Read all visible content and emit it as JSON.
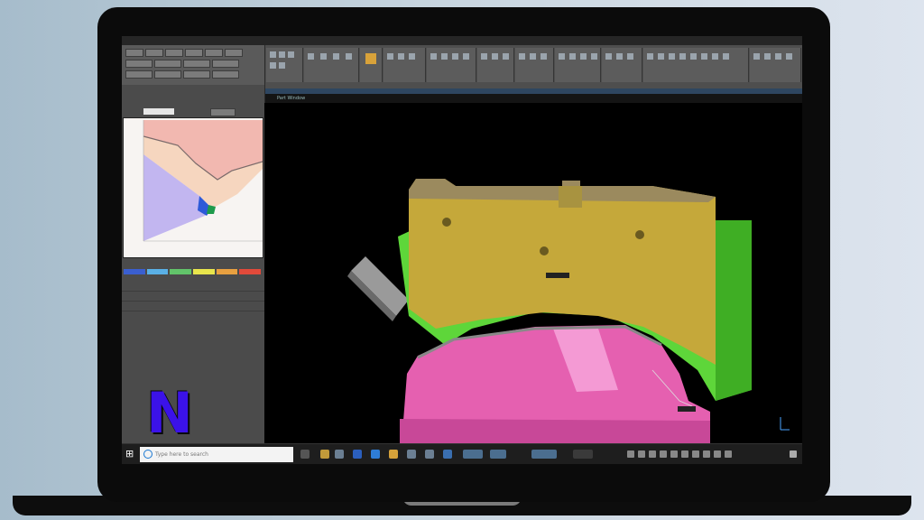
{
  "app": {
    "window_title": "",
    "viewport_tab": "Part Window",
    "viewport_labels": [
      "",
      ""
    ]
  },
  "ribbon": {
    "groups": [
      "",
      "",
      "",
      "",
      "",
      "",
      "",
      "",
      "",
      "",
      ""
    ]
  },
  "left_panel": {
    "rows": [
      "",
      "",
      ""
    ],
    "legend_colors": [
      "#3a5fd0",
      "#5ab0e6",
      "#62c46a",
      "#e8e54c",
      "#e8a040",
      "#e24a3a"
    ]
  },
  "logo": {
    "text": "N",
    "color": "#3b12e8"
  },
  "taskbar": {
    "search_placeholder": "Type here to search",
    "clock_time": "",
    "clock_date": ""
  },
  "colors": {
    "die_top": "#c5a83a",
    "die_mid": "#5ed63a",
    "die_bottom": "#e560b0"
  }
}
